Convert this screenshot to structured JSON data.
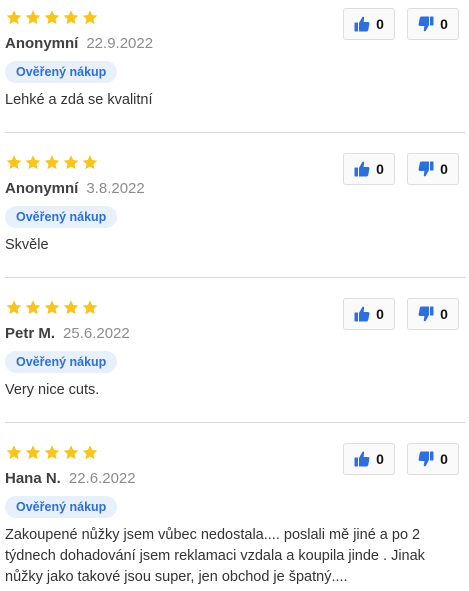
{
  "colors": {
    "star": "#f7c51d",
    "thumb": "#2e6fe0",
    "badge_bg": "#e8f0fb",
    "badge_text": "#2d6fd6"
  },
  "icons": {
    "star": "star-icon",
    "like": "thumbs-up-icon",
    "dislike": "thumbs-down-icon"
  },
  "reviews": [
    {
      "rating": 5,
      "author": "Anonymní",
      "date": "22.9.2022",
      "badge": "Ověřený nákup",
      "text": "Lehké a zdá se kvalitní",
      "likes": "0",
      "dislikes": "0"
    },
    {
      "rating": 5,
      "author": "Anonymní",
      "date": "3.8.2022",
      "badge": "Ověřený nákup",
      "text": "Skvěle",
      "likes": "0",
      "dislikes": "0"
    },
    {
      "rating": 5,
      "author": "Petr M.",
      "date": "25.6.2022",
      "badge": "Ověřený nákup",
      "text": "Very nice cuts.",
      "likes": "0",
      "dislikes": "0"
    },
    {
      "rating": 5,
      "author": "Hana N.",
      "date": "22.6.2022",
      "badge": "Ověřený nákup",
      "text": "Zakoupené nůžky jsem vůbec nedostala.... poslali mě jiné a po 2 týdnech dohadování jsem reklamaci vzdala a koupila jinde . Jinak nůžky jako takové jsou super, jen obchod je špatný....",
      "likes": "0",
      "dislikes": "0"
    }
  ]
}
